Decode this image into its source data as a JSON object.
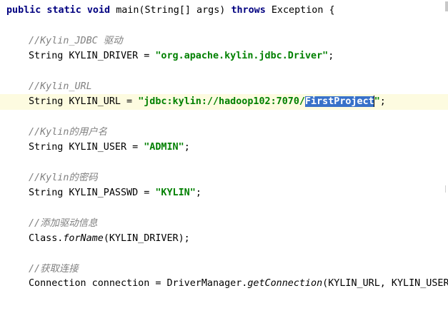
{
  "editor": {
    "lines": [
      {
        "id": "sig",
        "parts": [
          {
            "t": "public static void ",
            "c": "kw"
          },
          {
            "t": "main(String[] args) ",
            "c": ""
          },
          {
            "t": "throws ",
            "c": "kw"
          },
          {
            "t": "Exception {",
            "c": ""
          }
        ]
      },
      {
        "id": "c1",
        "parts": [
          {
            "t": "//Kylin_JDBC 驱动",
            "c": "cmt"
          }
        ]
      },
      {
        "id": "l1",
        "parts": [
          {
            "t": "String KYLIN_DRIVER = ",
            "c": ""
          },
          {
            "t": "\"org.apache.kylin.jdbc.Driver\"",
            "c": "str"
          },
          {
            "t": ";",
            "c": ""
          }
        ]
      },
      {
        "id": "c2",
        "parts": [
          {
            "t": "//Kylin_URL",
            "c": "cmt"
          }
        ]
      },
      {
        "id": "l2",
        "parts": [
          {
            "t": "String KYLIN_URL = ",
            "c": ""
          },
          {
            "t": "\"jdbc:kylin://hadoop102:7070/",
            "c": "str"
          },
          {
            "t": "FirstProject",
            "c": "str sel"
          },
          {
            "t": "\"",
            "c": "str"
          },
          {
            "t": ";",
            "c": ""
          }
        ]
      },
      {
        "id": "c3",
        "parts": [
          {
            "t": "//Kylin的用户名",
            "c": "cmt"
          }
        ]
      },
      {
        "id": "l3",
        "parts": [
          {
            "t": "String KYLIN_USER = ",
            "c": ""
          },
          {
            "t": "\"ADMIN\"",
            "c": "str"
          },
          {
            "t": ";",
            "c": ""
          }
        ]
      },
      {
        "id": "c4",
        "parts": [
          {
            "t": "//Kylin的密码",
            "c": "cmt"
          }
        ]
      },
      {
        "id": "l4",
        "parts": [
          {
            "t": "String KYLIN_PASSWD = ",
            "c": ""
          },
          {
            "t": "\"KYLIN\"",
            "c": "str"
          },
          {
            "t": ";",
            "c": ""
          }
        ]
      },
      {
        "id": "c5",
        "parts": [
          {
            "t": "//添加驱动信息",
            "c": "cmt"
          }
        ]
      },
      {
        "id": "l5",
        "parts": [
          {
            "t": "Class.",
            "c": ""
          },
          {
            "t": "forName",
            "c": "call"
          },
          {
            "t": "(KYLIN_DRIVER);",
            "c": ""
          }
        ]
      },
      {
        "id": "c6",
        "parts": [
          {
            "t": "//获取连接",
            "c": "cmt"
          }
        ]
      },
      {
        "id": "l6",
        "parts": [
          {
            "t": "Connection connection = DriverManager.",
            "c": ""
          },
          {
            "t": "getConnection",
            "c": "call"
          },
          {
            "t": "(KYLIN_URL, KYLIN_USER,",
            "c": ""
          }
        ]
      }
    ]
  },
  "colors": {
    "keyword": "#000080",
    "string": "#008000",
    "comment": "#808080",
    "selection": "#3871c9",
    "current_line": "#fdfbe0"
  }
}
